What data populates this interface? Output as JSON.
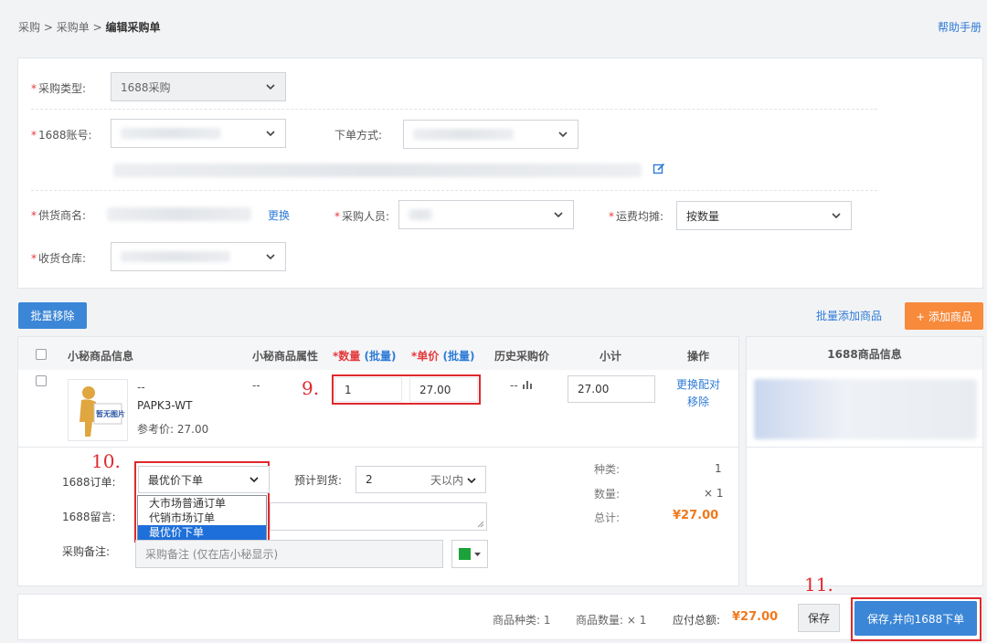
{
  "breadcrumb": {
    "items": [
      "采购",
      "采购单"
    ],
    "current": "编辑采购单",
    "sep": ">"
  },
  "help": "帮助手册",
  "form": {
    "type": {
      "label": "采购类型:",
      "value": "1688采购"
    },
    "account": {
      "label": "1688账号:",
      "value": ""
    },
    "order_method": {
      "label": "下单方式:",
      "value": ""
    },
    "supplier": {
      "label": "供货商名:",
      "change_link": "更换"
    },
    "buyer": {
      "label": "采购人员:",
      "value": ""
    },
    "freight": {
      "label": "运费均摊:",
      "value": "按数量"
    },
    "warehouse": {
      "label": "收货仓库:",
      "value": ""
    }
  },
  "toolbar": {
    "batch_remove": "批量移除",
    "batch_add": "批量添加商品",
    "add_product": "+ 添加商品"
  },
  "table": {
    "headers": {
      "info": "小秘商品信息",
      "attr": "小秘商品属性",
      "qty": "*数量",
      "qty_batch": "(批量)",
      "price": "*单价",
      "price_batch": "(批量)",
      "history": "历史采购价",
      "subtotal": "小计",
      "ops": "操作"
    },
    "right_header": "1688商品信息",
    "row": {
      "name": "--",
      "sku": "PAPK3-WT",
      "ref_price": "参考价: 27.00",
      "image_label": "暂无图片",
      "attr": "--",
      "qty": "1",
      "price": "27.00",
      "history": "--",
      "subtotal": "27.00",
      "op_rematch": "更换配对",
      "op_remove": "移除"
    }
  },
  "detail": {
    "order_label": "1688订单:",
    "order_value": "最优价下单",
    "order_options": [
      "大市场普通订单",
      "代销市场订单",
      "最优价下单"
    ],
    "eta_label": "预计到货:",
    "eta_value": "2",
    "eta_unit": "天以内",
    "message_label": "1688留言:",
    "remark_label": "采购备注:",
    "remark_placeholder": "采购备注 (仅在店小秘显示)",
    "kinds_label": "种类:",
    "kinds_value": "1",
    "qty_label": "数量:",
    "qty_value": "× 1",
    "total_label": "总计:",
    "total_value": "¥27.00"
  },
  "footer": {
    "kinds": "商品种类: 1",
    "qty": "商品数量: × 1",
    "payable_label": "应付总额:",
    "payable_value": "¥27.00",
    "save": "保存",
    "save_order": "保存,并向1688下单"
  },
  "annotations": {
    "step9": "9.",
    "step10": "10.",
    "step11": "11."
  },
  "colors": {
    "accent": "#3b86d6",
    "orange": "#f78a3b",
    "annotation": "#e0282c",
    "flag": "#1aa33a"
  }
}
